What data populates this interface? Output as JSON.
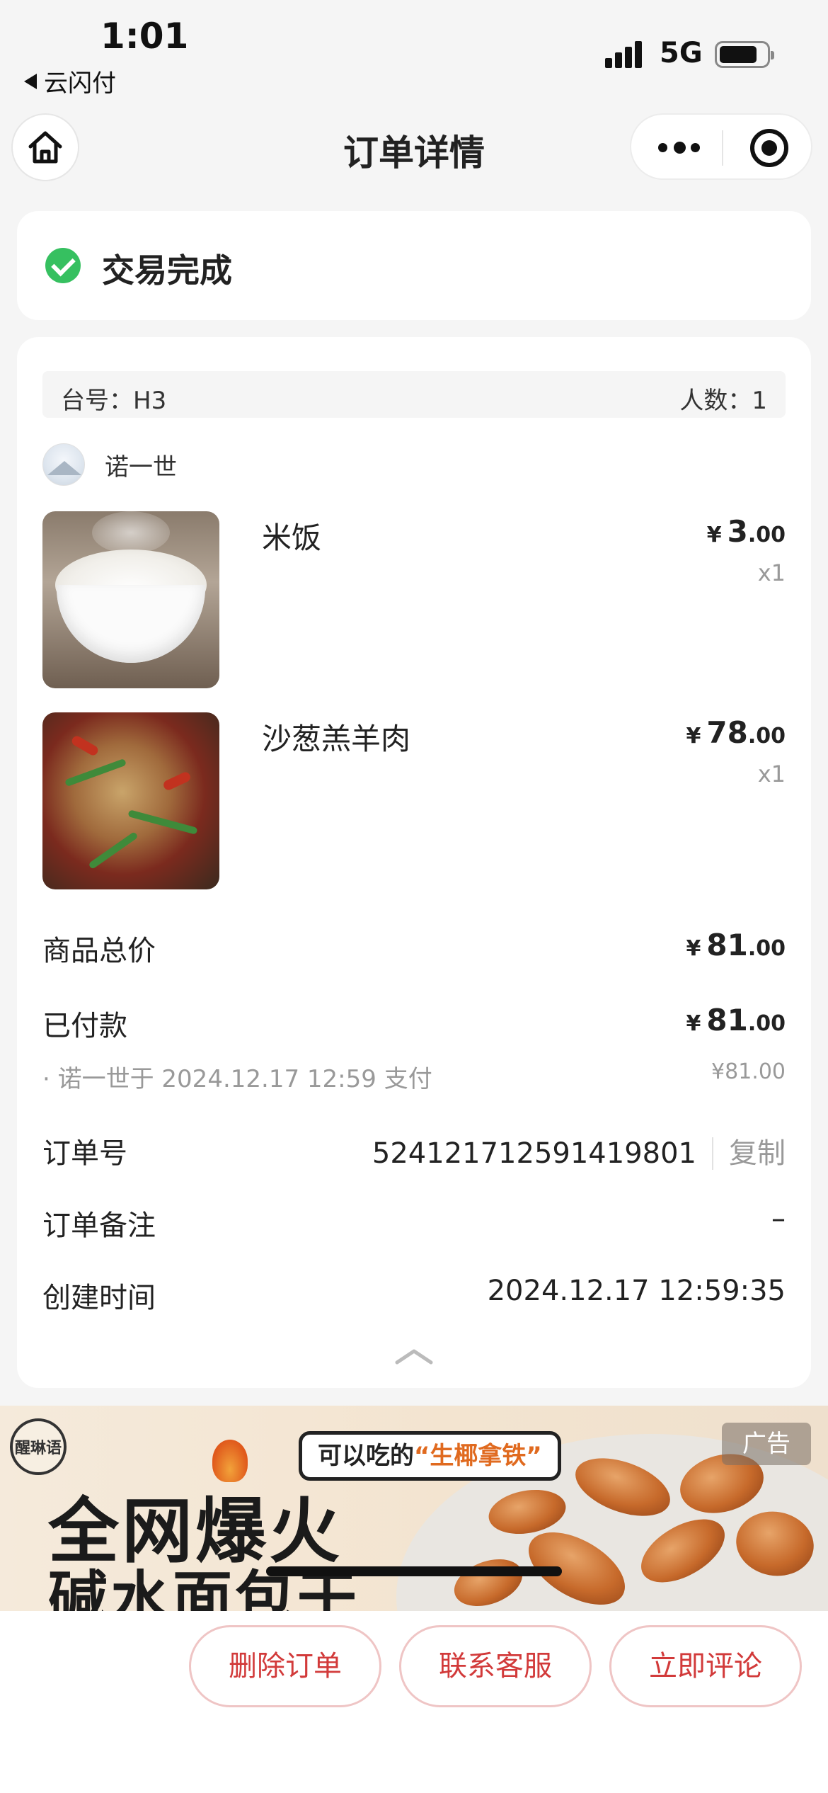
{
  "status_bar": {
    "time": "1:01",
    "back_app": "云闪付",
    "network": "5G"
  },
  "nav": {
    "title": "订单详情"
  },
  "order_status": {
    "text": "交易完成",
    "color": "#36c060"
  },
  "table_info": {
    "table_label": "台号：H3",
    "people_label": "人数：1"
  },
  "user": {
    "name": "诺一世"
  },
  "items": [
    {
      "name": "米饭",
      "currency": "¥",
      "price_int": "3",
      "price_dec": ".00",
      "qty": "x1"
    },
    {
      "name": "沙葱羔羊肉",
      "currency": "¥",
      "price_int": "78",
      "price_dec": ".00",
      "qty": "x1"
    }
  ],
  "summary": {
    "subtotal_label": "商品总价",
    "subtotal_currency": "¥",
    "subtotal_int": "81",
    "subtotal_dec": ".00",
    "paid_label": "已付款",
    "paid_currency": "¥",
    "paid_int": "81",
    "paid_dec": ".00",
    "payment_note": "· 诺一世于 2024.12.17 12:59 支付",
    "payment_amount": "¥81.00",
    "order_no_label": "订单号",
    "order_no": "524121712591419801",
    "copy_label": "复制",
    "remark_label": "订单备注",
    "remark_value": "–",
    "created_label": "创建时间",
    "created_value": "2024.12.17 12:59:35"
  },
  "ad": {
    "logo_text": "醒琳语",
    "tag": "广告",
    "bubble_prefix": "可以吃的",
    "bubble_highlight": "“生椰拿铁”",
    "headline1": "全网爆火",
    "headline2": "碱水面包干"
  },
  "actions": {
    "delete_label": "删除订单",
    "service_label": "联系客服",
    "review_label": "立即评论",
    "accent_color": "#d23a3a"
  }
}
